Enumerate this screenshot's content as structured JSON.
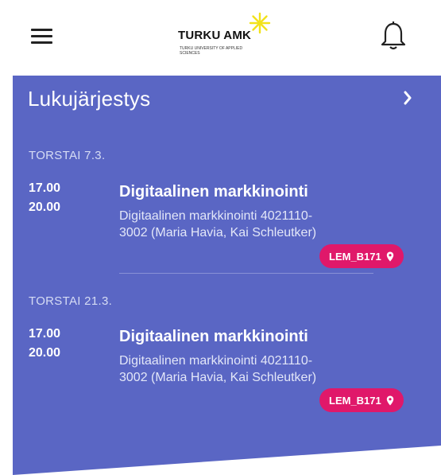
{
  "header": {
    "menu_icon": "hamburger-menu-icon",
    "logo_title": "TURKU AMK",
    "logo_sub": "TURKU UNIVERSITY OF APPLIED SCIENCES",
    "notifications_icon": "bell-icon"
  },
  "colors": {
    "card": "#5a66c4",
    "room_badge": "#e0186a"
  },
  "schedule": {
    "title": "Lukujärjestys",
    "arrow_icon": "chevron-right-icon",
    "days": [
      {
        "label": "TORSTAI 7.3.",
        "event": {
          "start": "17.00",
          "end": "20.00",
          "title": "Digitaalinen markkinointi",
          "description": "Digitaalinen markkinointi 4021110-3002 (Maria Havia, Kai Schleutker)",
          "room": "LEM_B171",
          "room_icon": "location-pin-icon"
        }
      },
      {
        "label": "TORSTAI 21.3.",
        "event": {
          "start": "17.00",
          "end": "20.00",
          "title": "Digitaalinen markkinointi",
          "description": "Digitaalinen markkinointi 4021110-3002 (Maria Havia, Kai Schleutker)",
          "room": "LEM_B171",
          "room_icon": "location-pin-icon"
        }
      }
    ]
  }
}
